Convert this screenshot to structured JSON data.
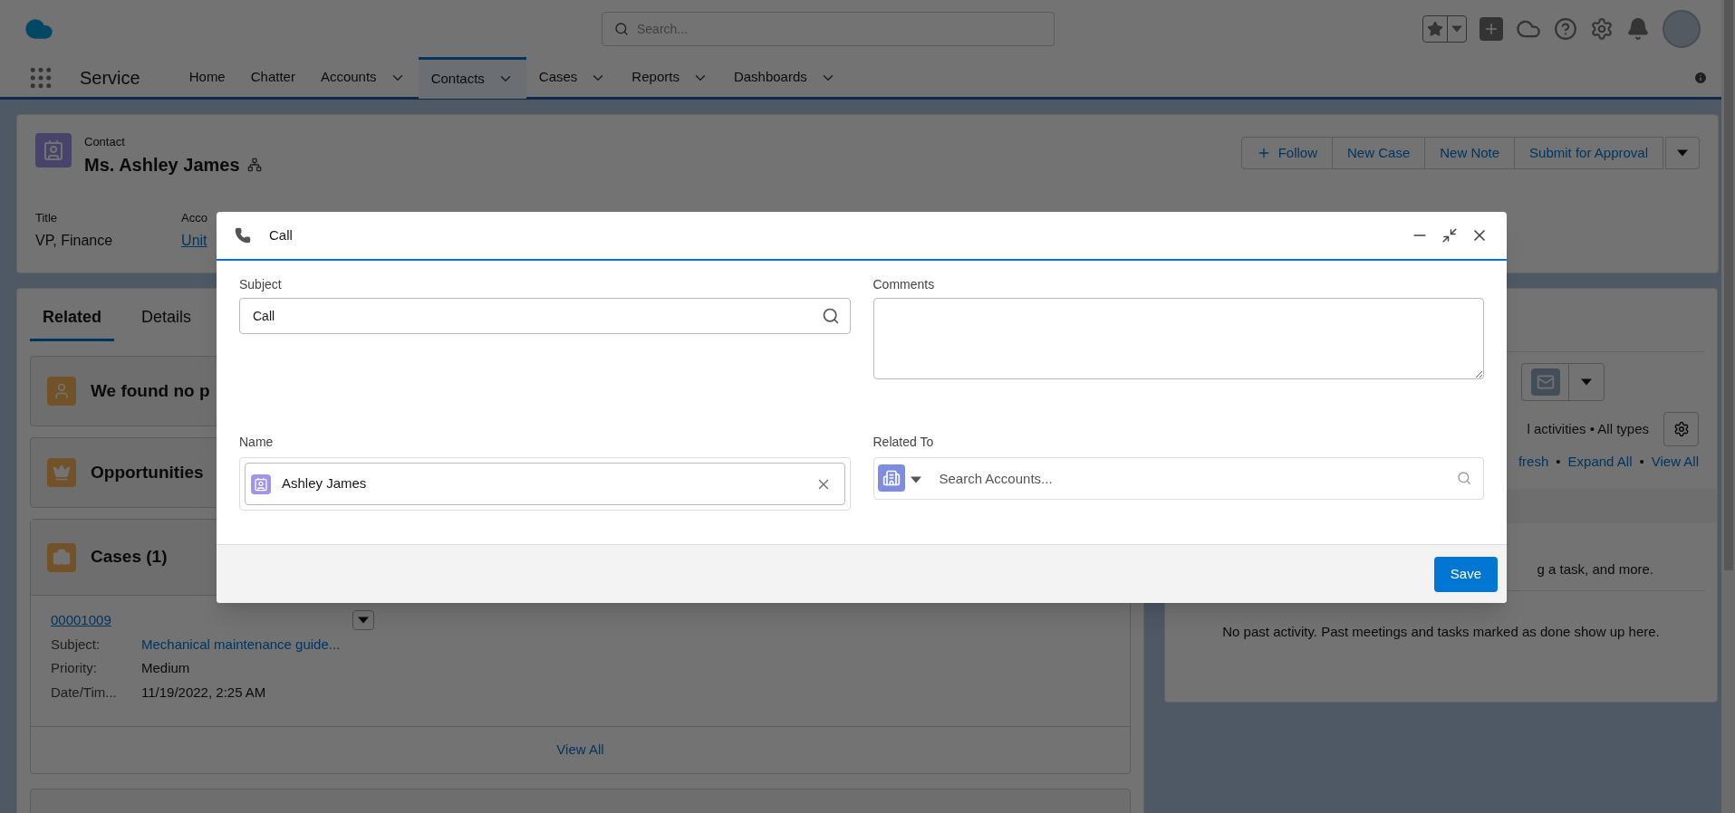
{
  "header": {
    "search_placeholder": "Search..."
  },
  "nav": {
    "app_name": "Service",
    "tabs": [
      {
        "label": "Home",
        "menu": false,
        "selected": false
      },
      {
        "label": "Chatter",
        "menu": false,
        "selected": false
      },
      {
        "label": "Accounts",
        "menu": true,
        "selected": false
      },
      {
        "label": "Contacts",
        "menu": true,
        "selected": true
      },
      {
        "label": "Cases",
        "menu": true,
        "selected": false
      },
      {
        "label": "Reports",
        "menu": true,
        "selected": false
      },
      {
        "label": "Dashboards",
        "menu": true,
        "selected": false
      }
    ]
  },
  "record": {
    "object": "Contact",
    "name": "Ms. Ashley James",
    "actions": [
      {
        "label": "Follow",
        "icon": true
      },
      {
        "label": "New Case",
        "icon": false
      },
      {
        "label": "New Note",
        "icon": false
      },
      {
        "label": "Submit for Approval",
        "icon": false
      }
    ],
    "fields": [
      {
        "label": "Title",
        "value": "VP, Finance",
        "link": false
      },
      {
        "label": "Acco",
        "value": "Unit",
        "link": true
      }
    ]
  },
  "left": {
    "tabs": [
      {
        "label": "Related",
        "selected": true
      },
      {
        "label": "Details",
        "selected": false
      }
    ],
    "cards": [
      {
        "title": "We found no p",
        "kind": "duplicates"
      },
      {
        "title": "Opportunities",
        "kind": "opportunities"
      }
    ],
    "cases": {
      "title": "Cases (1)",
      "number": "00001009",
      "rows": [
        {
          "label": "Subject:",
          "value": "Mechanical maintenance guide...",
          "link": true
        },
        {
          "label": "Priority:",
          "value": "Medium",
          "link": false
        },
        {
          "label": "Date/Tim...",
          "value": "11/19/2022, 2:25 AM",
          "link": false
        }
      ],
      "footer": "View All"
    }
  },
  "activity": {
    "filter": "l activities • All types",
    "links": [
      "fresh",
      "Expand All",
      "View All"
    ],
    "separator": "•",
    "upcoming": "g a task, and more.",
    "past": "No past activity. Past meetings and tasks marked as done show up here."
  },
  "modal": {
    "title": "Call",
    "subject": {
      "label": "Subject",
      "value": "Call"
    },
    "comments": {
      "label": "Comments"
    },
    "name": {
      "label": "Name",
      "value": "Ashley James"
    },
    "related": {
      "label": "Related To",
      "placeholder": "Search Accounts..."
    },
    "save": "Save"
  }
}
